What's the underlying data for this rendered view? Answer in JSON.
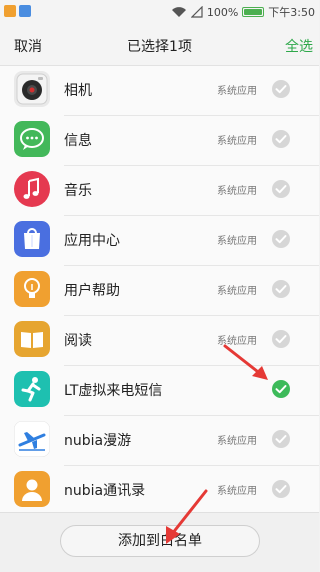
{
  "status_bar": {
    "battery": "100%",
    "time": "下午3:50",
    "battery_level": 1.0
  },
  "header": {
    "cancel_label": "取消",
    "title": "已选择1项",
    "select_all_label": "全选"
  },
  "apps": [
    {
      "name": "相机",
      "tag": "系统应用",
      "checked": false,
      "icon": "camera-icon"
    },
    {
      "name": "信息",
      "tag": "系统应用",
      "checked": false,
      "icon": "message-icon"
    },
    {
      "name": "音乐",
      "tag": "系统应用",
      "checked": false,
      "icon": "music-icon"
    },
    {
      "name": "应用中心",
      "tag": "系统应用",
      "checked": false,
      "icon": "app-center-icon"
    },
    {
      "name": "用户帮助",
      "tag": "系统应用",
      "checked": false,
      "icon": "help-bulb-icon"
    },
    {
      "name": "阅读",
      "tag": "系统应用",
      "checked": false,
      "icon": "book-icon"
    },
    {
      "name": "LT虚拟来电短信",
      "tag": "",
      "checked": true,
      "icon": "running-man-icon"
    },
    {
      "name": "nubia漫游",
      "tag": "系统应用",
      "checked": false,
      "icon": "airplane-icon"
    },
    {
      "name": "nubia通讯录",
      "tag": "系统应用",
      "checked": false,
      "icon": "contacts-icon"
    }
  ],
  "footer": {
    "add_button_label": "添加到白名单"
  },
  "colors": {
    "accent_green": "#2ea84a",
    "check_on": "#3dba5a",
    "annotation_red": "#e53935"
  }
}
